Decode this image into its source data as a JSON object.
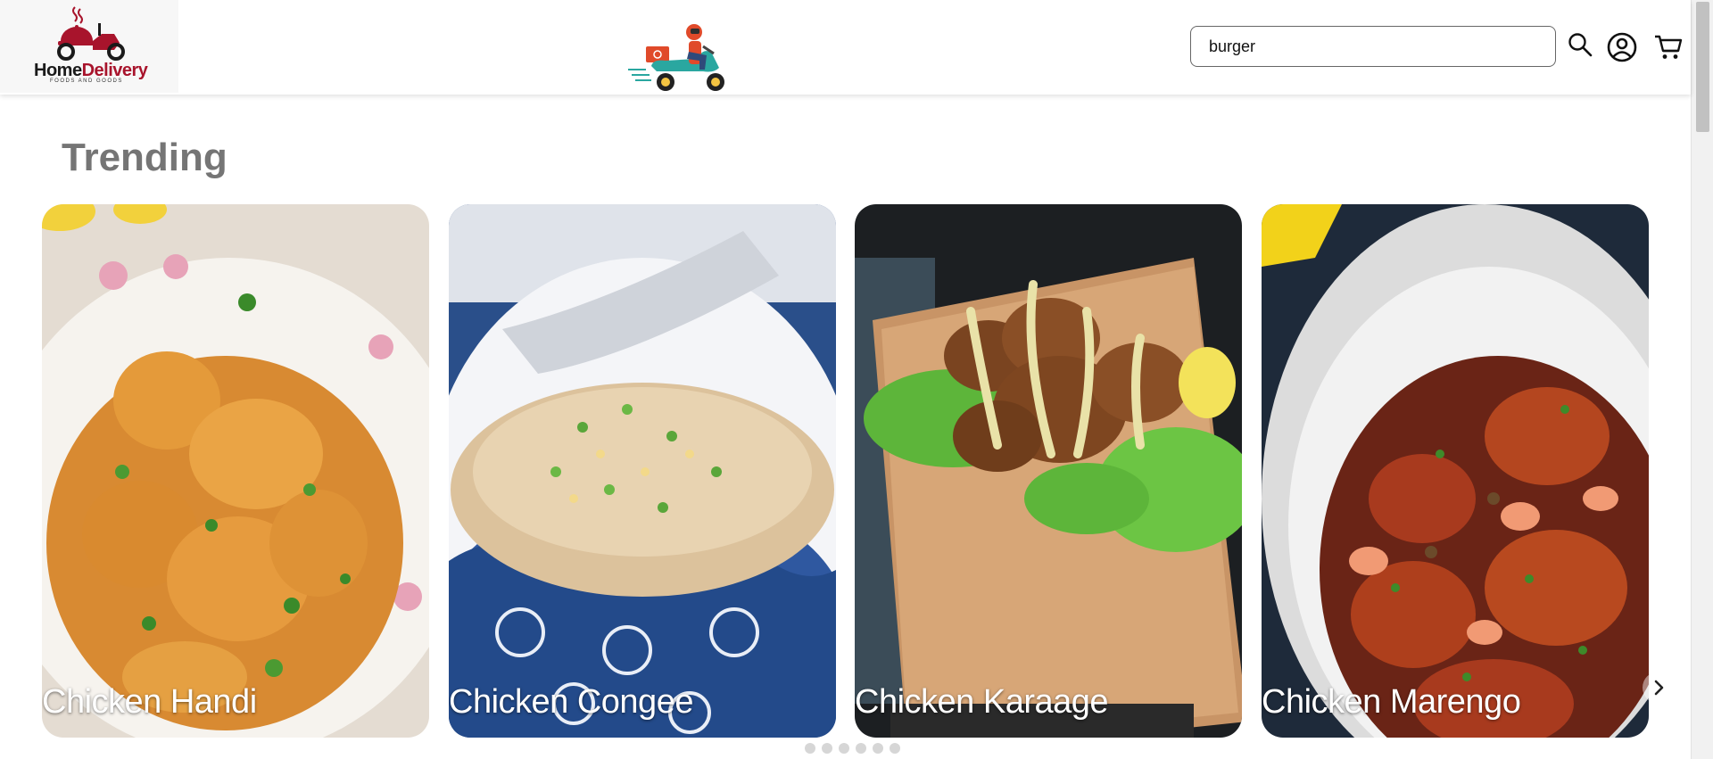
{
  "header": {
    "logo": {
      "brand_part1": "Home",
      "brand_part2": "Delivery",
      "tagline": "FOODS AND GOODS"
    },
    "search": {
      "value": "burger",
      "placeholder": "Search"
    },
    "icons": {
      "search": "search-icon",
      "account": "account-icon",
      "cart": "cart-icon"
    }
  },
  "trending": {
    "title": "Trending",
    "cards": [
      {
        "name": "Chicken Handi"
      },
      {
        "name": "Chicken Congee"
      },
      {
        "name": "Chicken Karaage"
      },
      {
        "name": "Chicken Marengo"
      }
    ],
    "dots_count": 6,
    "next_icon": "chevron-right-icon"
  },
  "colors": {
    "brand_red": "#a8142c",
    "title_gray": "#757575",
    "teal_scooter": "#2aa7a0"
  }
}
